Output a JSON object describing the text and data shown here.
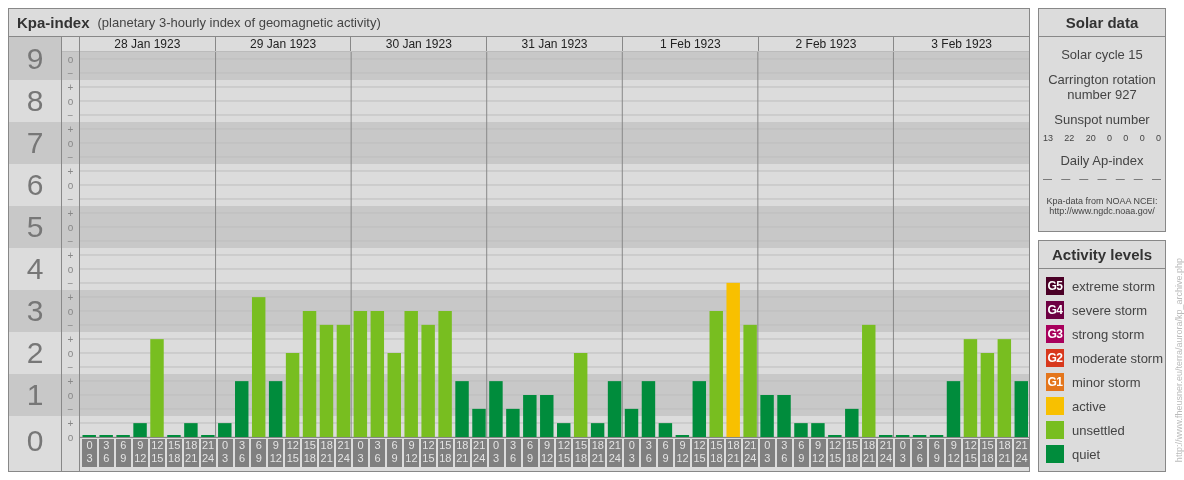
{
  "header": {
    "title": "Kpa-index",
    "subtitle": "(planetary 3-hourly index of geomagnetic activity)"
  },
  "levels": [
    {
      "marks": [
        "o",
        "−"
      ]
    },
    {
      "marks": [
        "+",
        "o",
        "−"
      ]
    },
    {
      "marks": [
        "+",
        "o",
        "−"
      ]
    },
    {
      "marks": [
        "+",
        "o",
        "−"
      ]
    },
    {
      "marks": [
        "+",
        "o",
        "−"
      ]
    },
    {
      "marks": [
        "+",
        "o",
        "−"
      ]
    },
    {
      "marks": [
        "+",
        "o",
        "−"
      ]
    },
    {
      "marks": [
        "+",
        "o",
        "−"
      ]
    },
    {
      "marks": [
        "+",
        "o",
        "−"
      ]
    },
    {
      "marks": [
        "+",
        "o"
      ]
    }
  ],
  "days": [
    "28 Jan 1923",
    "29 Jan 1923",
    "30 Jan 1923",
    "31 Jan 1923",
    "1 Feb 1923",
    "2 Feb 1923",
    "3 Feb 1923"
  ],
  "chart_data": {
    "type": "bar",
    "ylim": [
      0,
      9
    ],
    "grid": true,
    "yticks": [
      0,
      1,
      2,
      3,
      4,
      5,
      6,
      7,
      8,
      9
    ],
    "categories": [
      "0\n3",
      "3\n6",
      "6\n9",
      "9\n12",
      "12\n15",
      "15\n18",
      "18\n21",
      "21\n24",
      "0\n3",
      "3\n6",
      "6\n9",
      "9\n12",
      "12\n15",
      "15\n18",
      "18\n21",
      "21\n24",
      "0\n3",
      "3\n6",
      "6\n9",
      "9\n12",
      "12\n15",
      "15\n18",
      "18\n21",
      "21\n24",
      "0\n3",
      "3\n6",
      "6\n9",
      "9\n12",
      "12\n15",
      "15\n18",
      "18\n21",
      "21\n24",
      "0\n3",
      "3\n6",
      "6\n9",
      "9\n12",
      "12\n15",
      "15\n18",
      "18\n21",
      "21\n24",
      "0\n3",
      "3\n6",
      "6\n9",
      "9\n12",
      "12\n15",
      "15\n18",
      "18\n21",
      "21\n24",
      "0\n3",
      "3\n6",
      "6\n9",
      "9\n12",
      "12\n15",
      "15\n18",
      "18\n21",
      "21\n24"
    ],
    "series": [
      {
        "color": "#008c3c",
        "values": [
          0,
          0,
          0,
          0.33,
          null,
          0,
          0.33,
          0,
          0.33,
          1.33,
          null,
          1.33,
          null,
          null,
          null,
          null,
          null,
          null,
          null,
          null,
          null,
          null,
          1.33,
          0.67,
          1.33,
          0.67,
          1,
          1,
          0.33,
          null,
          0.33,
          1.33,
          0.67,
          1.33,
          0.33,
          0,
          1.33,
          null,
          null,
          null,
          1,
          1,
          0.33,
          0.33,
          0,
          0.67,
          null,
          0,
          0,
          0,
          0,
          1.33,
          null,
          null,
          null,
          1.33
        ]
      },
      {
        "color": "#78be20",
        "values": [
          null,
          null,
          null,
          null,
          2.33,
          null,
          null,
          null,
          null,
          null,
          3.33,
          null,
          2,
          3,
          2.67,
          2.67,
          3,
          3,
          2,
          3,
          2.67,
          3,
          null,
          null,
          null,
          null,
          null,
          null,
          null,
          2,
          null,
          null,
          null,
          null,
          null,
          null,
          null,
          3,
          null,
          2.67,
          null,
          null,
          null,
          null,
          null,
          null,
          2.67,
          null,
          null,
          null,
          null,
          null,
          2.33,
          2,
          2.33,
          null
        ]
      },
      {
        "color": "#f8c000",
        "values": [
          null,
          null,
          null,
          null,
          null,
          null,
          null,
          null,
          null,
          null,
          null,
          null,
          null,
          null,
          null,
          null,
          null,
          null,
          null,
          null,
          null,
          null,
          null,
          null,
          null,
          null,
          null,
          null,
          null,
          null,
          null,
          null,
          null,
          null,
          null,
          null,
          null,
          null,
          3.67,
          null,
          null,
          null,
          null,
          null,
          null,
          null,
          null,
          null,
          null,
          null,
          null,
          null,
          null,
          null,
          null,
          null
        ]
      }
    ]
  },
  "solar": {
    "title": "Solar data",
    "cycle": "Solar cycle 15",
    "rotation": "Carrington rotation number 927",
    "sunspot_label": "Sunspot number",
    "sunspots": [
      "13",
      "22",
      "20",
      "0",
      "0",
      "0",
      "0"
    ],
    "ap_label": "Daily Ap-index",
    "ap_values": [
      "—",
      "—",
      "—",
      "—",
      "—",
      "—",
      "—"
    ],
    "source": "Kpa-data from NOAA NCEI:",
    "source_url": "http://www.ngdc.noaa.gov/"
  },
  "activity": {
    "title": "Activity levels",
    "items": [
      {
        "badge": "G5",
        "label": "extreme storm",
        "color": "#4a0026"
      },
      {
        "badge": "G4",
        "label": "severe storm",
        "color": "#6e0042"
      },
      {
        "badge": "G3",
        "label": "strong storm",
        "color": "#a8005c"
      },
      {
        "badge": "G2",
        "label": "moderate storm",
        "color": "#d8381c"
      },
      {
        "badge": "G1",
        "label": "minor storm",
        "color": "#e4761c"
      },
      {
        "label": "active",
        "color": "#f8c000"
      },
      {
        "label": "unsettled",
        "color": "#78be20"
      },
      {
        "label": "quiet",
        "color": "#008c3c"
      }
    ]
  },
  "credit": "http://www.fheusner.eu/terra/aurora/kp_archive.php"
}
